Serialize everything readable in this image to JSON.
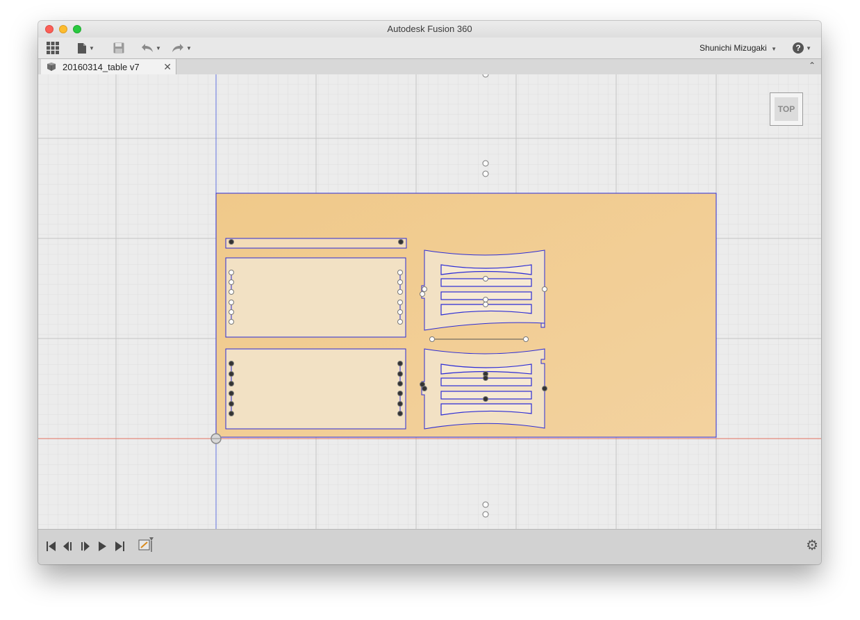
{
  "window": {
    "title": "Autodesk Fusion 360"
  },
  "toolbar": {
    "user_name": "Shunichi Mizugaki",
    "help_label": "?",
    "icons": [
      "apps-grid-icon",
      "file-menu-icon",
      "save-icon",
      "undo-icon",
      "redo-icon"
    ]
  },
  "tabs": [
    {
      "label": "20160314_table v7",
      "close": "✕"
    }
  ],
  "viewcube": {
    "face": "TOP"
  },
  "timeline": {
    "icons": [
      "go-to-start-icon",
      "step-back-icon",
      "step-forward-icon",
      "play-icon",
      "go-to-end-icon",
      "sketch-feature-icon"
    ],
    "settings_icon": "gear-icon"
  },
  "colors": {
    "sheet": "#f1cc90",
    "outline": "#2b2bd6",
    "grid": "#d6d6d6",
    "x_axis": "#e06a5a",
    "y_axis": "#5a68e0"
  }
}
